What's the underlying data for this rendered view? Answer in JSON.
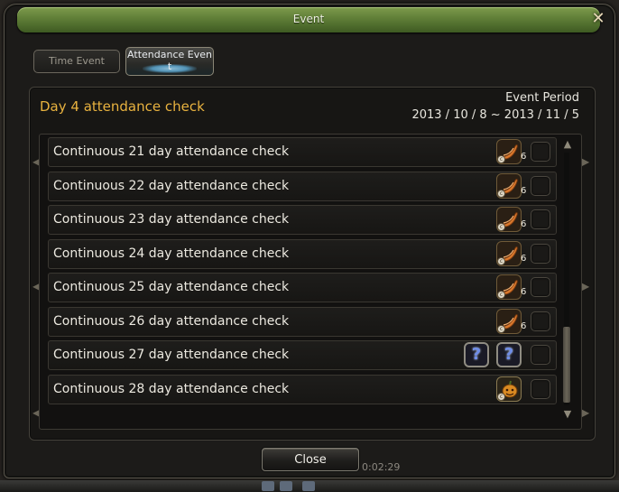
{
  "window": {
    "title": "Event",
    "close_symbol": "✕"
  },
  "tabs": [
    {
      "label": "Time Event",
      "active": false
    },
    {
      "label": "Attendance Even\nt",
      "active": true
    }
  ],
  "header": {
    "day_title": "Day 4 attendance check",
    "event_period_label": "Event Period",
    "event_period_range": "2013 / 10 / 8 ~ 2013 / 11 / 5"
  },
  "rows": [
    {
      "label": "Continuous 21 day attendance check",
      "reward": "horn-icon",
      "count": "6"
    },
    {
      "label": "Continuous 22 day attendance check",
      "reward": "horn-icon",
      "count": "6"
    },
    {
      "label": "Continuous 23 day attendance check",
      "reward": "horn-icon",
      "count": "6"
    },
    {
      "label": "Continuous 24 day attendance check",
      "reward": "horn-icon",
      "count": "6"
    },
    {
      "label": "Continuous 25 day attendance check",
      "reward": "horn-icon",
      "count": "6"
    },
    {
      "label": "Continuous 26 day attendance check",
      "reward": "horn-icon",
      "count": "6"
    },
    {
      "label": "Continuous 27 day attendance check",
      "reward": "question-icon",
      "count": ""
    },
    {
      "label": "Continuous 28 day attendance check",
      "reward": "pumpkin-icon",
      "count": ""
    }
  ],
  "footer": {
    "close_label": "Close",
    "timer": "0:02:29"
  },
  "icons": {
    "question_mark": "?",
    "scroll_up": "▲",
    "scroll_down": "▼",
    "side_left": "◀",
    "side_right": "▶"
  },
  "colors": {
    "titlebar": "#5f7e37",
    "day_title": "#e8b23f",
    "text": "#ece9e0"
  }
}
